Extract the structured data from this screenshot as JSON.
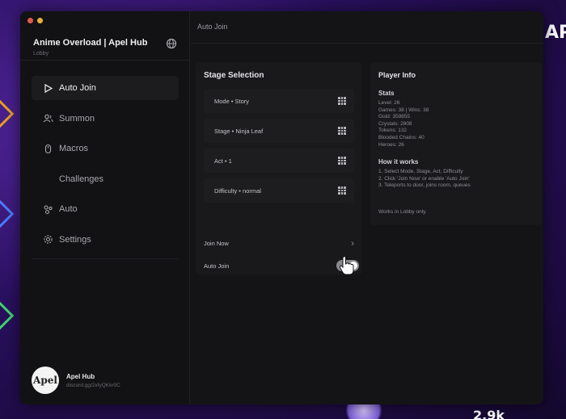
{
  "background": {
    "corner_text": "AP",
    "bottom_text": "2.9k"
  },
  "colors": {
    "window_bg": "#141416",
    "panel_bg": "#19191c",
    "accent_toggle": "#8a8a8e",
    "bg_purple": "#5a2aa8"
  },
  "sidebar": {
    "title": "Anime Overload | Apel Hub",
    "subtitle": "Lobby",
    "globe_icon": "globe-icon",
    "items": [
      {
        "label": "Auto Join",
        "icon": "play-icon",
        "active": true
      },
      {
        "label": "Summon",
        "icon": "users-icon",
        "active": false
      },
      {
        "label": "Macros",
        "icon": "macro-icon",
        "active": false
      },
      {
        "label": "Challenges",
        "icon": "",
        "active": false
      },
      {
        "label": "Auto",
        "icon": "auto-icon",
        "active": false
      },
      {
        "label": "Settings",
        "icon": "gear-icon",
        "active": false
      }
    ],
    "profile": {
      "avatar_text": "Apel",
      "name": "Apel Hub",
      "discord": "discord.gg/2xfyQKkr0C"
    }
  },
  "header": {
    "breadcrumb": "Auto Join"
  },
  "stage_selection": {
    "title": "Stage Selection",
    "selects": [
      {
        "label": "Mode • Story"
      },
      {
        "label": "Stage • Ninja Leaf"
      },
      {
        "label": "Act • 1"
      },
      {
        "label": "Difficulty • normal"
      }
    ],
    "join_now_label": "Join Now",
    "auto_join_label": "Auto Join",
    "auto_join_enabled": true
  },
  "player_info": {
    "title": "Player Info",
    "stats_heading": "Stats",
    "stats": [
      "Level: 26",
      "Games: 38 | Wins: 38",
      "Gold: 359855",
      "Crystals: 2808",
      "Tokens: 132",
      "Blooded Chains: 40",
      "Heroes: 26"
    ],
    "how_heading": "How it works",
    "how_steps": [
      "1. Select Mode, Stage, Act, Difficulty",
      "2. Click 'Join Now' or enable 'Auto Join'",
      "3. Teleports to door, joins room, queues"
    ],
    "note": "Works in Lobby only."
  }
}
